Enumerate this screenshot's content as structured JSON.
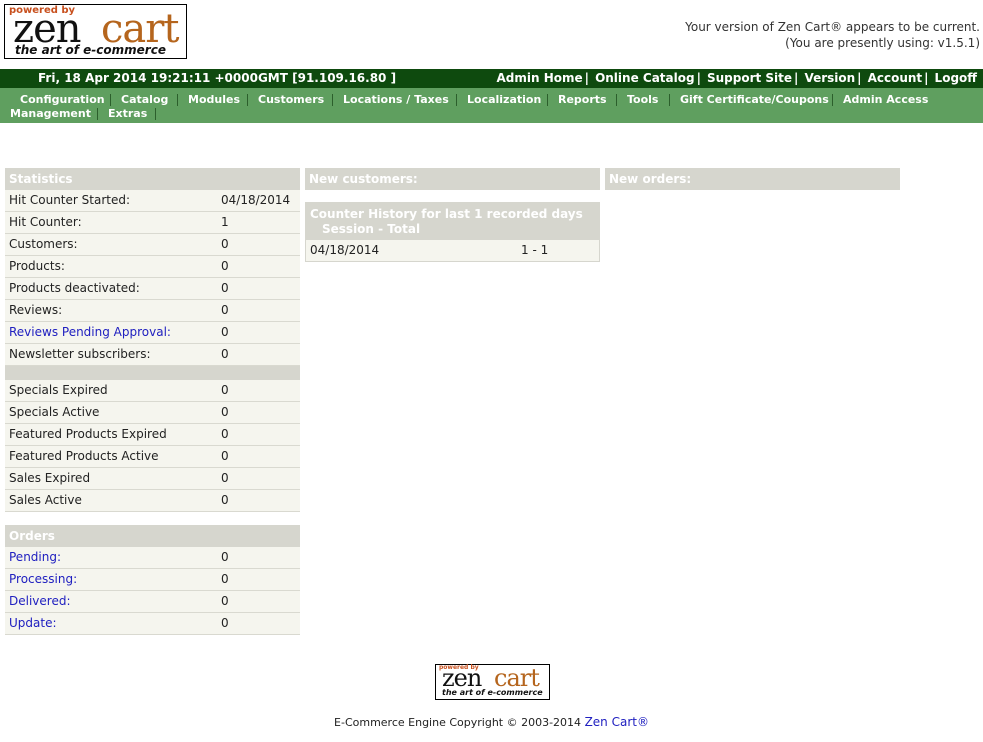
{
  "logo": {
    "powered_by": "powered by",
    "zen": "zen",
    "cart": "cart",
    "tagline": "the art of e-commerce"
  },
  "version": {
    "line1": "Your version of Zen Cart® appears to be current.",
    "line2": "(You are presently using: v1.5.1)"
  },
  "header": {
    "datetime": "Fri, 18 Apr 2014 19:21:11 +0000GMT [91.109.16.80 ]",
    "links": [
      "Admin Home",
      "Online Catalog",
      "Support Site",
      "Version",
      "Account",
      "Logoff"
    ],
    "separator": "|"
  },
  "menu": {
    "items": [
      "Configuration",
      "Catalog",
      "Modules",
      "Customers",
      "Locations / Taxes",
      "Localization",
      "Reports",
      "Tools",
      "Gift Certificate/Coupons",
      "Admin Access Management",
      "Extras"
    ],
    "access_line1": "Admin Access",
    "access_line2": "Management"
  },
  "statistics": {
    "title": "Statistics",
    "rows": [
      {
        "label": "Hit Counter Started:",
        "value": "04/18/2014"
      },
      {
        "label": "Hit Counter:",
        "value": "1"
      },
      {
        "label": "Customers:",
        "value": "0"
      },
      {
        "label": "Products:",
        "value": "0"
      },
      {
        "label": "Products deactivated:",
        "value": "0"
      },
      {
        "label": "Reviews:",
        "value": "0"
      },
      {
        "label": "Reviews Pending Approval:",
        "value": "0"
      },
      {
        "label": "Newsletter subscribers:",
        "value": "0"
      }
    ],
    "rows2": [
      {
        "label": "Specials Expired",
        "value": "0"
      },
      {
        "label": "Specials Active",
        "value": "0"
      },
      {
        "label": "Featured Products Expired",
        "value": "0"
      },
      {
        "label": "Featured Products Active",
        "value": "0"
      },
      {
        "label": "Sales Expired",
        "value": "0"
      },
      {
        "label": "Sales Active",
        "value": "0"
      }
    ]
  },
  "orders": {
    "title": "Orders",
    "rows": [
      {
        "label": "Pending:",
        "value": "0"
      },
      {
        "label": "Processing:",
        "value": "0"
      },
      {
        "label": "Delivered:",
        "value": "0"
      },
      {
        "label": "Update:",
        "value": "0"
      }
    ]
  },
  "new_customers": {
    "title": "New customers:"
  },
  "new_orders": {
    "title": "New orders:"
  },
  "counter_history": {
    "title": "Counter History for last 1 recorded days",
    "subtitle": "Session - Total",
    "date": "04/18/2014",
    "value": "1 - 1"
  },
  "footer": {
    "copyright": "E-Commerce Engine Copyright © 2003-2014",
    "brand": "Zen Cart®"
  }
}
